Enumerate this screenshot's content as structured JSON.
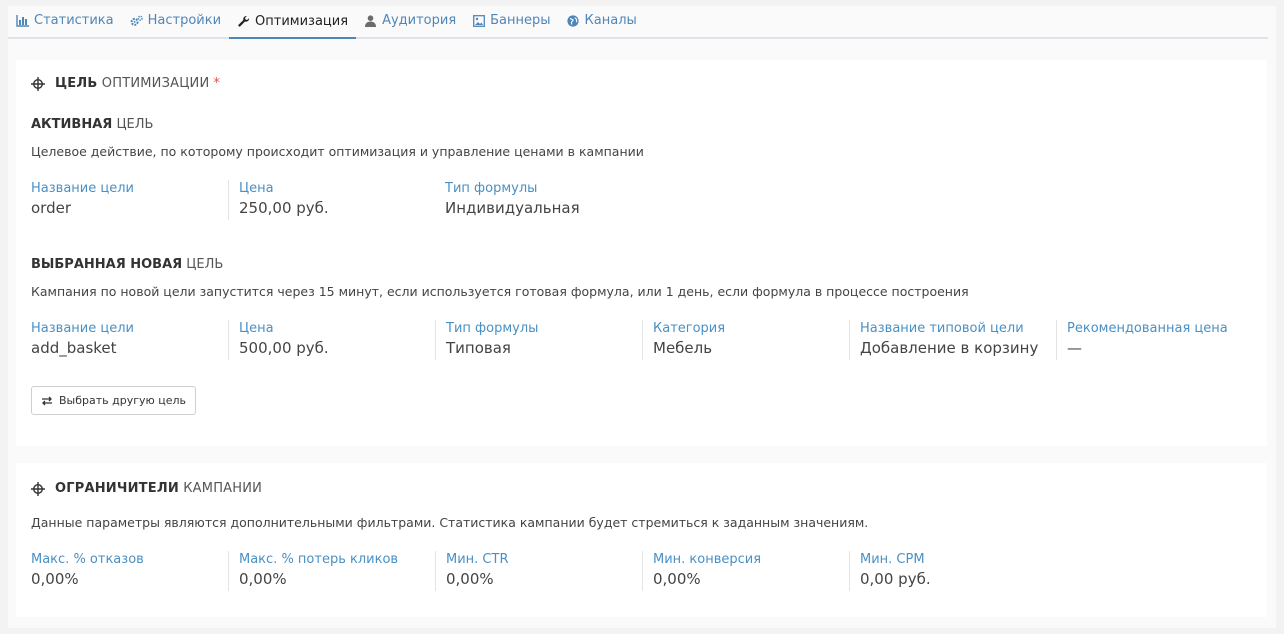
{
  "tabs": [
    {
      "label": "Статистика",
      "icon": "bar-chart-icon",
      "active": false
    },
    {
      "label": "Настройки",
      "icon": "gears-icon",
      "active": false
    },
    {
      "label": "Оптимизация",
      "icon": "wrench-icon",
      "active": true
    },
    {
      "label": "Аудитория",
      "icon": "user-icon",
      "active": false
    },
    {
      "label": "Баннеры",
      "icon": "image-icon",
      "active": false
    },
    {
      "label": "Каналы",
      "icon": "globe-icon",
      "active": false
    }
  ],
  "goal_section": {
    "title_bold": "ЦЕЛЬ",
    "title_rest": "ОПТИМИЗАЦИИ",
    "required_mark": "*",
    "active": {
      "title_bold": "АКТИВНАЯ",
      "title_rest": "ЦЕЛЬ",
      "description": "Целевое действие, по которому происходит оптимизация и управление ценами в кампании",
      "fields": [
        {
          "label": "Название цели",
          "value": "order"
        },
        {
          "label": "Цена",
          "value": "250,00 руб."
        },
        {
          "label": "Тип формулы",
          "value": "Индивидуальная"
        }
      ]
    },
    "new": {
      "title_bold": "ВЫБРАННАЯ НОВАЯ",
      "title_rest": "ЦЕЛЬ",
      "description": "Кампания по новой цели запустится через 15 минут, если используется готовая формула, или 1 день, если формула в процессе построения",
      "fields": [
        {
          "label": "Название цели",
          "value": "add_basket"
        },
        {
          "label": "Цена",
          "value": "500,00 руб."
        },
        {
          "label": "Тип формулы",
          "value": "Типовая"
        },
        {
          "label": "Категория",
          "value": "Мебель"
        },
        {
          "label": "Название типовой цели",
          "value": "Добавление в корзину"
        },
        {
          "label": "Рекомендованная цена",
          "value": "—"
        }
      ]
    },
    "choose_button": "Выбрать другую цель"
  },
  "limits_section": {
    "title_bold": "ОГРАНИЧИТЕЛИ",
    "title_rest": "КАМПАНИИ",
    "description": "Данные параметры являются дополнительными фильтрами. Статистика кампании будет стремиться к заданным значениям.",
    "fields": [
      {
        "label": "Макс. % отказов",
        "value": "0,00%"
      },
      {
        "label": "Макс. % потерь кликов",
        "value": "0,00%"
      },
      {
        "label": "Мин. CTR",
        "value": "0,00%"
      },
      {
        "label": "Мин. конверсия",
        "value": "0,00%"
      },
      {
        "label": "Мин. CPM",
        "value": "0,00 руб."
      }
    ]
  },
  "colors": {
    "accent": "#4a90c4",
    "required": "#d9534f"
  }
}
